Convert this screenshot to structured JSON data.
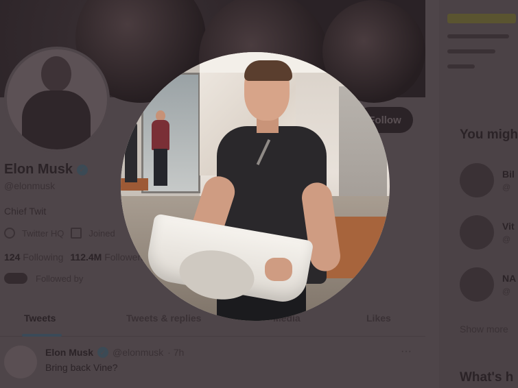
{
  "profile": {
    "name": "Elon Musk",
    "handle": "@elonmusk",
    "bio": "Chief Twit",
    "location": "Twitter HQ",
    "joined": "Joined",
    "following_count": "124",
    "following_label": "Following",
    "followers_count": "112.4M",
    "followers_label": "Followers",
    "followed_by": "Followed by",
    "follow_button": "Follow"
  },
  "tabs": [
    "Tweets",
    "Tweets & replies",
    "Media",
    "Likes"
  ],
  "tweet": {
    "name": "Elon Musk",
    "handle": "@elonmusk",
    "time": "· 7h",
    "text": "Bring back Vine?",
    "more": "···"
  },
  "sidebar": {
    "heading": "You might",
    "suggestions": [
      {
        "name": "Bil",
        "sub": "@"
      },
      {
        "name": "Vit",
        "sub": "@"
      },
      {
        "name": "NA",
        "sub": "@"
      }
    ],
    "show_more": "Show more",
    "heading2": "What's h"
  }
}
